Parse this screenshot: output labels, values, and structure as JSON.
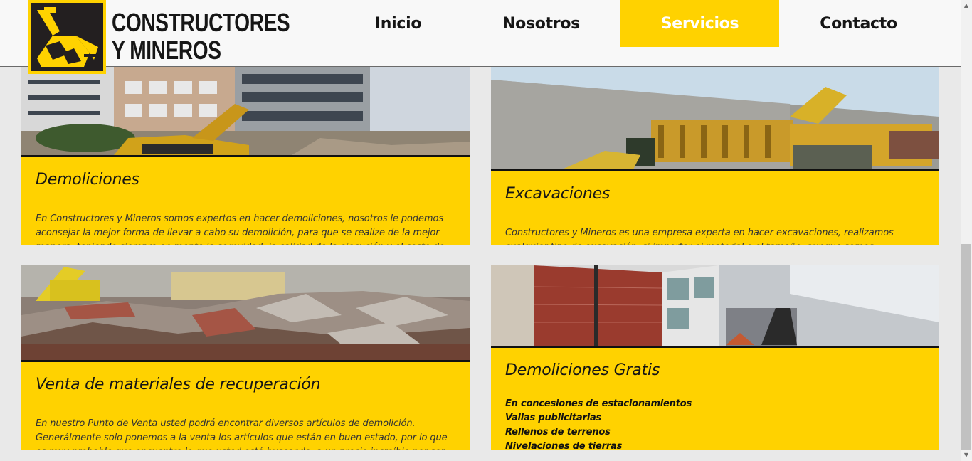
{
  "header": {
    "brand_line1": "CONSTRUCTORES",
    "brand_line2": "Y MINEROS",
    "nav": [
      {
        "label": "Inicio",
        "active": false
      },
      {
        "label": "Nosotros",
        "active": false
      },
      {
        "label": "Servicios",
        "active": true
      },
      {
        "label": "Contacto",
        "active": false
      }
    ]
  },
  "colors": {
    "accent": "#ffd200",
    "text": "#151515",
    "background": "#e9e9e9"
  },
  "services": [
    {
      "title": "Demoliciones",
      "text": "En Constructores y Mineros somos expertos en hacer demoliciones, nosotros le podemos aconsejar la mejor forma de llevar a cabo su demolición, para que se realize de la mejor manera, teniendo siempre en mente la seguridad, la calidad de la ejecución y el costo de la"
    },
    {
      "title": "Excavaciones",
      "text": "Constructores y Mineros es una empresa experta en hacer excavaciones, realizamos cualquier tipo de excavación, si importar el material o el tamaño, aunque somos especialistas en"
    },
    {
      "title": "Venta de materiales de recuperación",
      "text": "En nuestro Punto de Venta usted podrá encontrar diversos artículos de demolición. Generálmente solo ponemos a la venta los artículos que están en buen estado, por lo que es muy probable que encuentre lo que usted está buscando, a un precio increíble por ser de"
    },
    {
      "title": "Demoliciones Gratis",
      "items": [
        "En concesiones de estacionamientos",
        "Vallas publicitarias",
        "Rellenos de terrenos",
        "Nivelaciones de tierras"
      ]
    }
  ],
  "icons": {
    "logo": "excavator-logo-icon",
    "scroll_up": "chevron-up-icon",
    "scroll_down": "chevron-down-icon"
  }
}
